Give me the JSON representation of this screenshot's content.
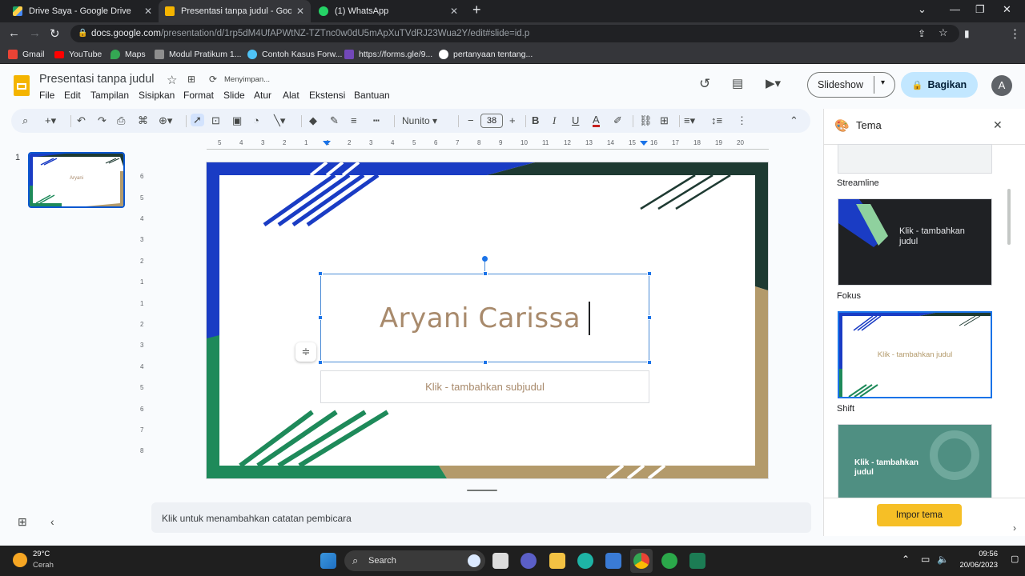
{
  "browser": {
    "tabs": [
      {
        "title": "Drive Saya - Google Drive",
        "active": false
      },
      {
        "title": "Presentasi tanpa judul - Google S",
        "active": true
      },
      {
        "title": "(1) WhatsApp",
        "active": false
      }
    ],
    "url_main": "docs.google.com",
    "url_rest": "/presentation/d/1rp5dM4UfAPWtNZ-TZTnc0w0dU5mApXuTVdRJ23Wua2Y/edit#slide=id.p",
    "bookmarks": [
      "Gmail",
      "YouTube",
      "Maps",
      "Modul Pratikum 1...",
      "Contoh Kasus Forw...",
      "https://forms.gle/9...",
      "pertanyaan tentang..."
    ]
  },
  "app": {
    "doc_title": "Presentasi tanpa judul",
    "save_status": "Menyimpan...",
    "menu": [
      "File",
      "Edit",
      "Tampilan",
      "Sisipkan",
      "Format",
      "Slide",
      "Atur",
      "Alat",
      "Ekstensi",
      "Bantuan"
    ],
    "slideshow_label": "Slideshow",
    "share_label": "Bagikan",
    "avatar_letter": "A"
  },
  "toolbar": {
    "font_name": "Nunito",
    "font_size": "38"
  },
  "ruler": {
    "h_ticks": [
      "5",
      "4",
      "3",
      "2",
      "1",
      "1",
      "2",
      "3",
      "4",
      "5",
      "6",
      "7",
      "8",
      "9",
      "10",
      "11",
      "12",
      "13",
      "14",
      "15",
      "16",
      "17",
      "18",
      "19",
      "20"
    ],
    "v_ticks": [
      "6",
      "5",
      "4",
      "3",
      "2",
      "1",
      "1",
      "2",
      "3",
      "4",
      "5",
      "6",
      "7",
      "8"
    ]
  },
  "filmstrip": {
    "slide_number": "1",
    "thumb_title": "Aryani"
  },
  "slide": {
    "title": "Aryani Carissa",
    "subtitle_placeholder": "Klik - tambahkan subjudul",
    "colors": {
      "blue": "#1a3cc4",
      "green": "#1e8a5a",
      "dark": "#1e3a32",
      "gold": "#b39a6b"
    }
  },
  "notes_placeholder": "Klik untuk menambahkan catatan pembicara",
  "theme_panel": {
    "title": "Tema",
    "themes": [
      {
        "name": "Streamline",
        "preview_text": ""
      },
      {
        "name": "Fokus",
        "preview_text": "Klik - tambahkan judul"
      },
      {
        "name": "Shift",
        "preview_text": "Klik - tambahkan judul"
      },
      {
        "name": "",
        "preview_text": "Klik - tambahkan judul"
      }
    ],
    "import_label": "Impor tema"
  },
  "taskbar": {
    "weather_temp": "29°C",
    "weather_desc": "Cerah",
    "search_label": "Search",
    "time": "09:56",
    "date": "20/06/2023"
  }
}
